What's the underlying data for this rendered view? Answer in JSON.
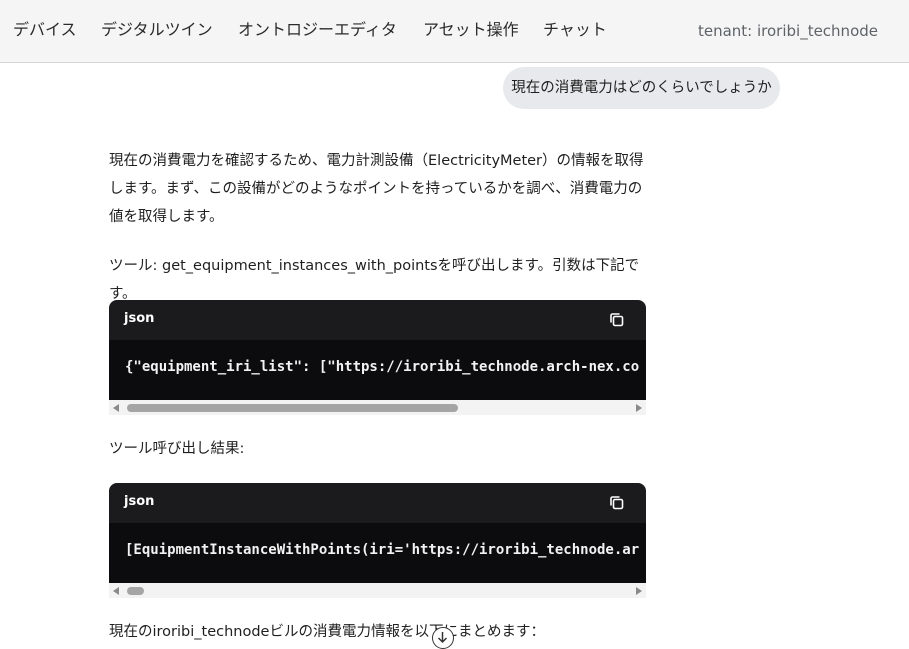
{
  "nav": {
    "items": [
      {
        "label": "デバイス"
      },
      {
        "label": "デジタルツイン"
      },
      {
        "label": "オントロジーエディタ"
      },
      {
        "label": "アセット操作"
      },
      {
        "label": "チャット"
      }
    ],
    "tenant": "tenant: iroribi_technode"
  },
  "chat": {
    "user_message": "現在の消費電力はどのくらいでしょうか",
    "assistant_intro": "現在の消費電力を確認するため、電力計測設備（ElectricityMeter）の情報を取得します。まず、この設備がどのようなポイントを持っているかを調べ、消費電力の値を取得します。",
    "tool_call_text": "ツール: get_equipment_instances_with_pointsを呼び出します。引数は下記です。",
    "code1": {
      "lang": "json",
      "content": "{\"equipment_iri_list\": [\"https://iroribi_technode.arch-nex.co",
      "scroll_fraction": 0.0
    },
    "tool_result_label": "ツール呼び出し結果:",
    "code2": {
      "lang": "json",
      "content": "[EquipmentInstanceWithPoints(iri='https://iroribi_technode.ar",
      "scroll_fraction": 0.0
    },
    "summary_text": "現在のiroribi_technodeビルの消費電力情報を以下にまとめます："
  },
  "icons": {
    "copy": "copy-icon",
    "scroll_down": "arrow-down-circle-icon"
  }
}
